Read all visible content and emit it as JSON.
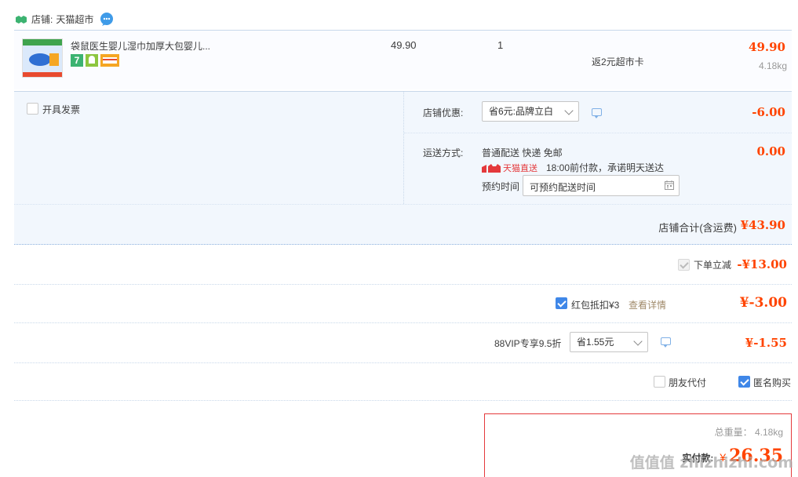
{
  "shop": {
    "label": "店铺:",
    "name": "天猫超市"
  },
  "item": {
    "title": "袋鼠医生婴儿湿巾加厚大包婴儿...",
    "badge_seven": "7",
    "unit_price": "49.90",
    "quantity": "1",
    "promo": "返2元超市卡",
    "subtotal": "49.90",
    "weight": "4.18kg"
  },
  "invoice": {
    "label": "开具发票"
  },
  "discount": {
    "label": "店铺优惠:",
    "selected": "省6元:品牌立白",
    "amount": "-6.00"
  },
  "shipping": {
    "label": "运送方式:",
    "method": "普通配送 快递 免邮",
    "amount": "0.00",
    "badge": "天猫直送",
    "promise": "18:00前付款，承诺明天送达",
    "schedule_label": "预约时间",
    "schedule_placeholder": "可预约配送时间"
  },
  "shop_total": {
    "label": "店铺合计(含运费)",
    "amount": "¥43.90"
  },
  "instant_discount": {
    "label": "下单立减",
    "amount": "-¥13.00"
  },
  "red_packet": {
    "label": "红包抵扣¥3",
    "link": "查看详情",
    "amount": "¥-3.00"
  },
  "vip": {
    "label": "88VIP专享9.5折",
    "selected": "省1.55元",
    "amount": "¥-1.55"
  },
  "options": {
    "friend_pay": "朋友代付",
    "anonymous": "匿名购买"
  },
  "summary": {
    "weight_label": "总重量：",
    "weight": "4.18kg",
    "pay_label": "实付款:",
    "currency": "¥",
    "amount": "26.35"
  },
  "watermark": "值值值 zhizhizhi.com",
  "colors": {
    "accent": "#ff4400",
    "link": "#3f87e8",
    "panel_bg": "#f2f7fd",
    "highlight_border": "#e4393c"
  }
}
